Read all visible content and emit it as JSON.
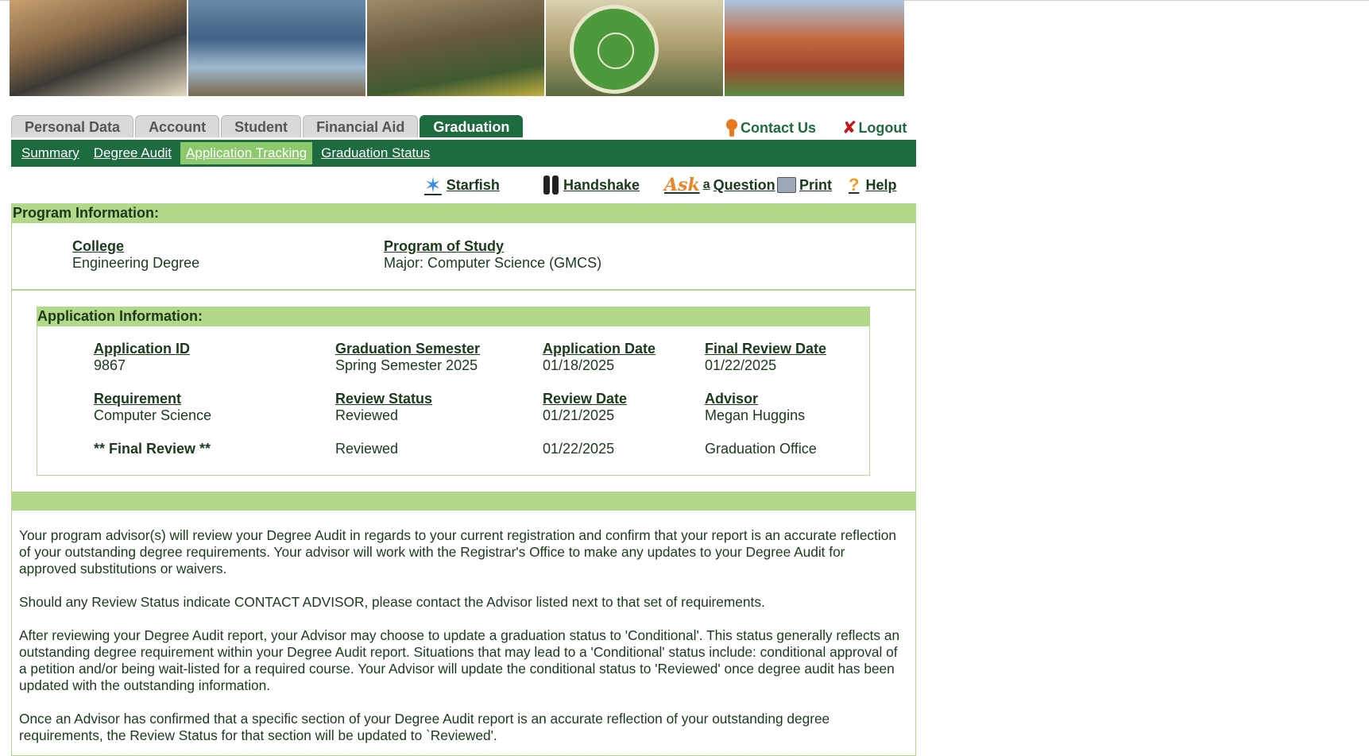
{
  "tabs": [
    "Personal Data",
    "Account",
    "Student",
    "Financial Aid",
    "Graduation"
  ],
  "active_tab": "Graduation",
  "top_links": {
    "contact": "Contact Us",
    "logout": "Logout"
  },
  "subnav": [
    "Summary",
    "Degree Audit",
    "Application Tracking",
    "Graduation Status"
  ],
  "active_subnav": "Application Tracking",
  "utility_links": {
    "starfish": "Starfish",
    "handshake": "Handshake",
    "ask_script": "Ask",
    "ask_a": "a",
    "question": "Question",
    "print": "Print",
    "help": "Help"
  },
  "program": {
    "header": "Program Information:",
    "college_label": "College",
    "college_value": "Engineering Degree",
    "program_label": "Program of Study",
    "program_value": "Major: Computer Science (GMCS)"
  },
  "application": {
    "header": "Application Information:",
    "app_id_label": "Application ID",
    "app_id_value": "9867",
    "grad_sem_label": "Graduation Semester",
    "grad_sem_value": "Spring Semester 2025",
    "app_date_label": "Application Date",
    "app_date_value": "01/18/2025",
    "final_review_date_label": "Final Review Date",
    "final_review_date_value": "01/22/2025",
    "requirement_label": "Requirement",
    "review_status_label": "Review Status",
    "review_date_label": "Review Date",
    "advisor_label": "Advisor",
    "rows": [
      {
        "requirement": "Computer Science",
        "status": "Reviewed",
        "date": "01/21/2025",
        "advisor": "Megan Huggins"
      },
      {
        "requirement": "** Final Review **",
        "status": "Reviewed",
        "date": "01/22/2025",
        "advisor": "Graduation Office"
      }
    ]
  },
  "paragraphs": [
    "Your program advisor(s) will review your Degree Audit in regards to your current registration and confirm that your report is an accurate reflection of your outstanding degree requirements. Your advisor will work with the Registrar's Office to make any updates to your Degree Audit for approved substitutions or waivers.",
    "Should any Review Status indicate CONTACT ADVISOR, please contact the Advisor listed next to that set of requirements.",
    "After reviewing your Degree Audit report, your Advisor may choose to update a graduation status to 'Conditional'. This status generally reflects an outstanding degree requirement within your Degree Audit report. Situations that may lead to a 'Conditional' status include: conditional approval of a petition and/or being wait-listed for a required course. Your Advisor will update the conditional status to 'Reviewed' once degree audit has been updated with the outstanding information.",
    "Once an Advisor has confirmed that a specific section of your Degree Audit report is an accurate reflection of your outstanding degree requirements, the Review Status for that section will be updated to `Reviewed'."
  ],
  "colors": {
    "brand_green": "#1e6b40",
    "light_green": "#b2d88a",
    "active_sub": "#8cc86c"
  }
}
